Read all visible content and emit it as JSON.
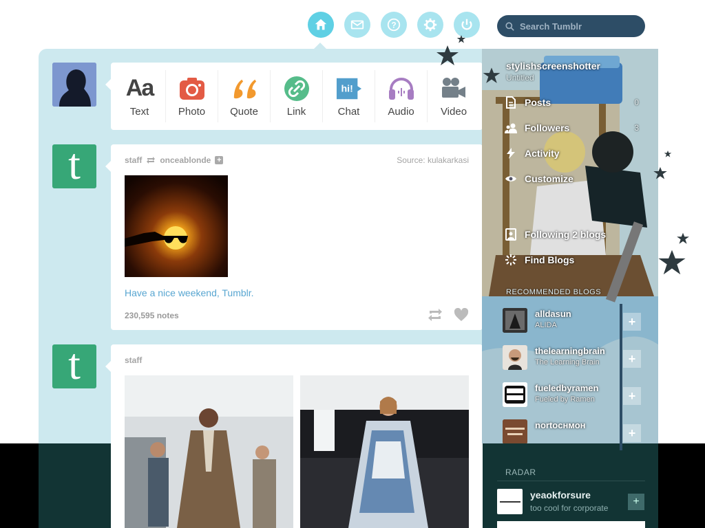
{
  "nav": {
    "icons": [
      "home-icon",
      "mail-icon",
      "help-icon",
      "gear-icon",
      "power-icon"
    ],
    "active": "home-icon",
    "search_placeholder": "Search Tumblr"
  },
  "post_types": [
    {
      "label": "Text",
      "icon": "text-icon",
      "color": "#444444"
    },
    {
      "label": "Photo",
      "icon": "camera-icon",
      "color": "#e35b45"
    },
    {
      "label": "Quote",
      "icon": "quote-icon",
      "color": "#f2992e"
    },
    {
      "label": "Link",
      "icon": "link-icon",
      "color": "#56bc8a"
    },
    {
      "label": "Chat",
      "icon": "chat-icon",
      "color": "#529ecc"
    },
    {
      "label": "Audio",
      "icon": "headphones-icon",
      "color": "#a77dc2"
    },
    {
      "label": "Video",
      "icon": "video-camera-icon",
      "color": "#748089"
    }
  ],
  "post1": {
    "author": "staff",
    "reblogged_from": "onceablonde",
    "source": "Source: kulakarkasi",
    "caption": "Have a nice weekend, Tumblr.",
    "notes": "230,595 notes"
  },
  "post2": {
    "author": "staff"
  },
  "sidebar": {
    "blog_name": "stylishscreenshotter",
    "blog_subtitle": "Untitled",
    "items": [
      {
        "label": "Posts",
        "count": "0",
        "icon": "document-icon"
      },
      {
        "label": "Followers",
        "count": "3",
        "icon": "followers-icon"
      },
      {
        "label": "Activity",
        "count": "",
        "icon": "activity-icon"
      },
      {
        "label": "Customize",
        "count": "",
        "icon": "eye-icon"
      },
      {
        "label": "Following 2 blogs",
        "count": "",
        "icon": "following-icon"
      },
      {
        "label": "Find Blogs",
        "count": "",
        "icon": "find-blogs-icon"
      }
    ],
    "recommended_heading": "RECOMMENDED BLOGS",
    "recommended": [
      {
        "name": "alldasun",
        "subtitle": "ALIDA",
        "avatar_color": "#2a2a2a"
      },
      {
        "name": "thelearningbrain",
        "subtitle": "The Learning Brain",
        "avatar_color": "#c79a7a"
      },
      {
        "name": "fueledbyramen",
        "subtitle": "Fueled by Ramen",
        "avatar_color": "#ffffff"
      },
      {
        "name": "nortoснмон",
        "subtitle": "",
        "avatar_color": "#7a4a30"
      }
    ]
  },
  "radar": {
    "heading": "RADAR",
    "name": "yeaokforsure",
    "subtitle": "too cool for corporate"
  }
}
